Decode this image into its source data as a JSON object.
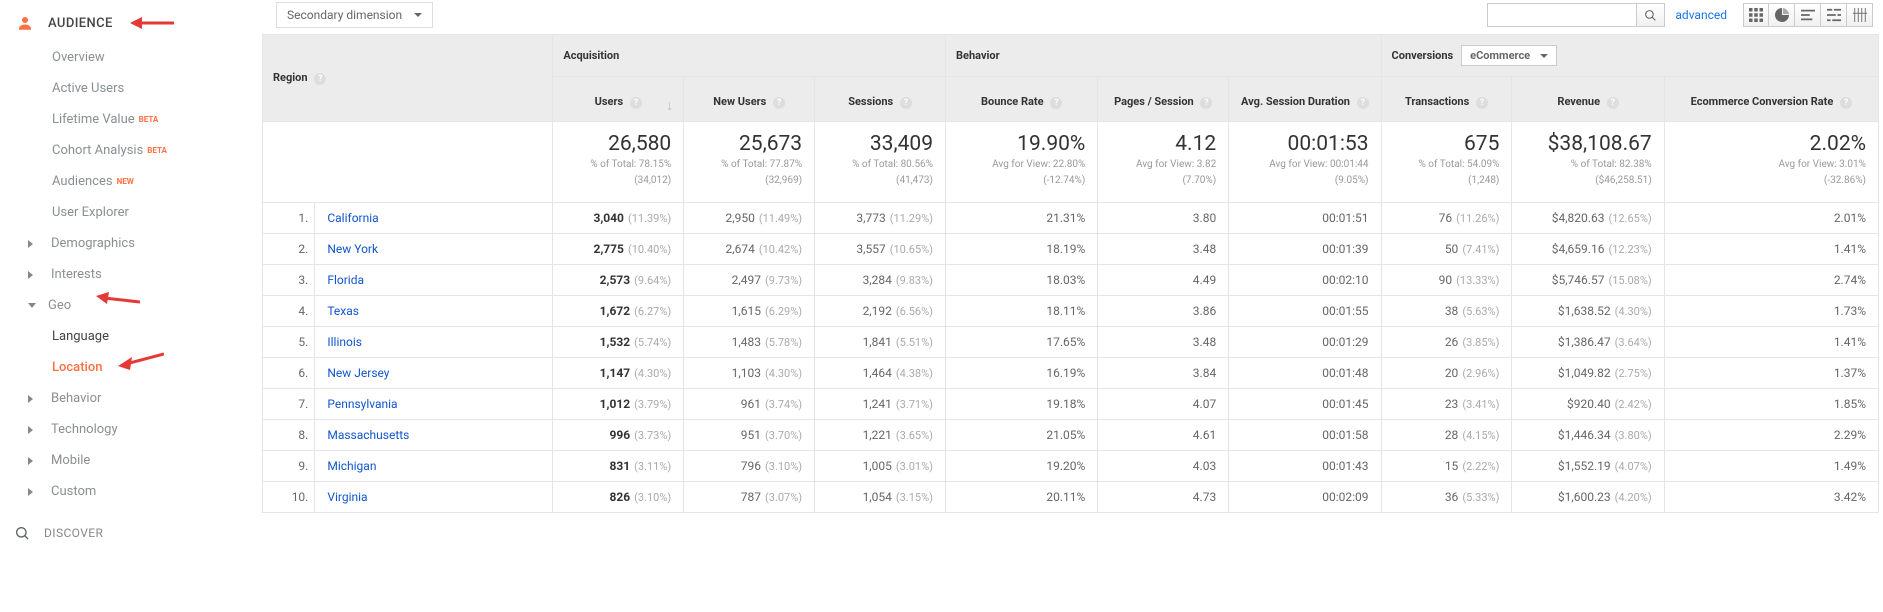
{
  "annotation_arrows": [
    "arrow-to-audience",
    "arrow-to-geo",
    "arrow-to-location"
  ],
  "sidebar": {
    "title": "AUDIENCE",
    "items": {
      "overview": "Overview",
      "active": "Active Users",
      "lifetime": "Lifetime Value",
      "lifetime_badge": "BETA",
      "cohort": "Cohort Analysis",
      "cohort_badge": "BETA",
      "audiences": "Audiences",
      "audiences_badge": "NEW",
      "userexp": "User Explorer",
      "demographics": "Demographics",
      "interests": "Interests",
      "geo": "Geo",
      "language": "Language",
      "location": "Location",
      "behavior": "Behavior",
      "technology": "Technology",
      "mobile": "Mobile",
      "custom": "Custom"
    },
    "discover": "DISCOVER"
  },
  "toolbar": {
    "secondary_dimension": "Secondary dimension",
    "search_placeholder": "",
    "advanced": "advanced"
  },
  "table": {
    "region_header": "Region",
    "groups": {
      "acquisition": "Acquisition",
      "behavior": "Behavior",
      "conversions_label": "Conversions",
      "conversions_select": "eCommerce"
    },
    "metric_headers": {
      "users": "Users",
      "new_users": "New Users",
      "sessions": "Sessions",
      "bounce_rate": "Bounce Rate",
      "pages_session": "Pages / Session",
      "avg_duration": "Avg. Session Duration",
      "transactions": "Transactions",
      "revenue": "Revenue",
      "ecr": "Ecommerce Conversion Rate"
    },
    "summary": {
      "users": {
        "value": "26,580",
        "sub1": "% of Total: 78.15%",
        "sub2": "(34,012)"
      },
      "new_users": {
        "value": "25,673",
        "sub1": "% of Total: 77.87%",
        "sub2": "(32,969)"
      },
      "sessions": {
        "value": "33,409",
        "sub1": "% of Total: 80.56%",
        "sub2": "(41,473)"
      },
      "bounce_rate": {
        "value": "19.90%",
        "sub1": "Avg for View: 22.80%",
        "sub2": "(-12.74%)"
      },
      "pages_session": {
        "value": "4.12",
        "sub1": "Avg for View: 3.82",
        "sub2": "(7.70%)"
      },
      "avg_duration": {
        "value": "00:01:53",
        "sub1": "Avg for View: 00:01:44",
        "sub2": "(9.05%)"
      },
      "transactions": {
        "value": "675",
        "sub1": "% of Total: 54.09%",
        "sub2": "(1,248)"
      },
      "revenue": {
        "value": "$38,108.67",
        "sub1": "% of Total: 82.38%",
        "sub2": "($46,258.51)"
      },
      "ecr": {
        "value": "2.02%",
        "sub1": "Avg for View: 3.01%",
        "sub2": "(-32.86%)"
      }
    },
    "rows": [
      {
        "n": "1.",
        "region": "California",
        "users": "3,040",
        "users_pct": "(11.39%)",
        "new_users": "2,950",
        "new_users_pct": "(11.49%)",
        "sessions": "3,773",
        "sessions_pct": "(11.29%)",
        "bounce": "21.31%",
        "pps": "3.80",
        "dur": "00:01:51",
        "trans": "76",
        "trans_pct": "(11.26%)",
        "rev": "$4,820.63",
        "rev_pct": "(12.65%)",
        "ecr": "2.01%"
      },
      {
        "n": "2.",
        "region": "New York",
        "users": "2,775",
        "users_pct": "(10.40%)",
        "new_users": "2,674",
        "new_users_pct": "(10.42%)",
        "sessions": "3,557",
        "sessions_pct": "(10.65%)",
        "bounce": "18.19%",
        "pps": "3.48",
        "dur": "00:01:39",
        "trans": "50",
        "trans_pct": "(7.41%)",
        "rev": "$4,659.16",
        "rev_pct": "(12.23%)",
        "ecr": "1.41%"
      },
      {
        "n": "3.",
        "region": "Florida",
        "users": "2,573",
        "users_pct": "(9.64%)",
        "new_users": "2,497",
        "new_users_pct": "(9.73%)",
        "sessions": "3,284",
        "sessions_pct": "(9.83%)",
        "bounce": "18.03%",
        "pps": "4.49",
        "dur": "00:02:10",
        "trans": "90",
        "trans_pct": "(13.33%)",
        "rev": "$5,746.57",
        "rev_pct": "(15.08%)",
        "ecr": "2.74%"
      },
      {
        "n": "4.",
        "region": "Texas",
        "users": "1,672",
        "users_pct": "(6.27%)",
        "new_users": "1,615",
        "new_users_pct": "(6.29%)",
        "sessions": "2,192",
        "sessions_pct": "(6.56%)",
        "bounce": "18.11%",
        "pps": "3.86",
        "dur": "00:01:55",
        "trans": "38",
        "trans_pct": "(5.63%)",
        "rev": "$1,638.52",
        "rev_pct": "(4.30%)",
        "ecr": "1.73%"
      },
      {
        "n": "5.",
        "region": "Illinois",
        "users": "1,532",
        "users_pct": "(5.74%)",
        "new_users": "1,483",
        "new_users_pct": "(5.78%)",
        "sessions": "1,841",
        "sessions_pct": "(5.51%)",
        "bounce": "17.65%",
        "pps": "3.48",
        "dur": "00:01:29",
        "trans": "26",
        "trans_pct": "(3.85%)",
        "rev": "$1,386.47",
        "rev_pct": "(3.64%)",
        "ecr": "1.41%"
      },
      {
        "n": "6.",
        "region": "New Jersey",
        "users": "1,147",
        "users_pct": "(4.30%)",
        "new_users": "1,103",
        "new_users_pct": "(4.30%)",
        "sessions": "1,464",
        "sessions_pct": "(4.38%)",
        "bounce": "16.19%",
        "pps": "3.84",
        "dur": "00:01:48",
        "trans": "20",
        "trans_pct": "(2.96%)",
        "rev": "$1,049.82",
        "rev_pct": "(2.75%)",
        "ecr": "1.37%"
      },
      {
        "n": "7.",
        "region": "Pennsylvania",
        "users": "1,012",
        "users_pct": "(3.79%)",
        "new_users": "961",
        "new_users_pct": "(3.74%)",
        "sessions": "1,241",
        "sessions_pct": "(3.71%)",
        "bounce": "19.18%",
        "pps": "4.07",
        "dur": "00:01:45",
        "trans": "23",
        "trans_pct": "(3.41%)",
        "rev": "$920.40",
        "rev_pct": "(2.42%)",
        "ecr": "1.85%"
      },
      {
        "n": "8.",
        "region": "Massachusetts",
        "users": "996",
        "users_pct": "(3.73%)",
        "new_users": "951",
        "new_users_pct": "(3.70%)",
        "sessions": "1,221",
        "sessions_pct": "(3.65%)",
        "bounce": "21.05%",
        "pps": "4.61",
        "dur": "00:01:58",
        "trans": "28",
        "trans_pct": "(4.15%)",
        "rev": "$1,446.34",
        "rev_pct": "(3.80%)",
        "ecr": "2.29%"
      },
      {
        "n": "9.",
        "region": "Michigan",
        "users": "831",
        "users_pct": "(3.11%)",
        "new_users": "796",
        "new_users_pct": "(3.10%)",
        "sessions": "1,005",
        "sessions_pct": "(3.01%)",
        "bounce": "19.20%",
        "pps": "4.03",
        "dur": "00:01:43",
        "trans": "15",
        "trans_pct": "(2.22%)",
        "rev": "$1,552.19",
        "rev_pct": "(4.07%)",
        "ecr": "1.49%"
      },
      {
        "n": "10.",
        "region": "Virginia",
        "users": "826",
        "users_pct": "(3.10%)",
        "new_users": "787",
        "new_users_pct": "(3.07%)",
        "sessions": "1,054",
        "sessions_pct": "(3.15%)",
        "bounce": "20.11%",
        "pps": "4.73",
        "dur": "00:02:09",
        "trans": "36",
        "trans_pct": "(5.33%)",
        "rev": "$1,600.23",
        "rev_pct": "(4.20%)",
        "ecr": "3.42%"
      }
    ]
  }
}
